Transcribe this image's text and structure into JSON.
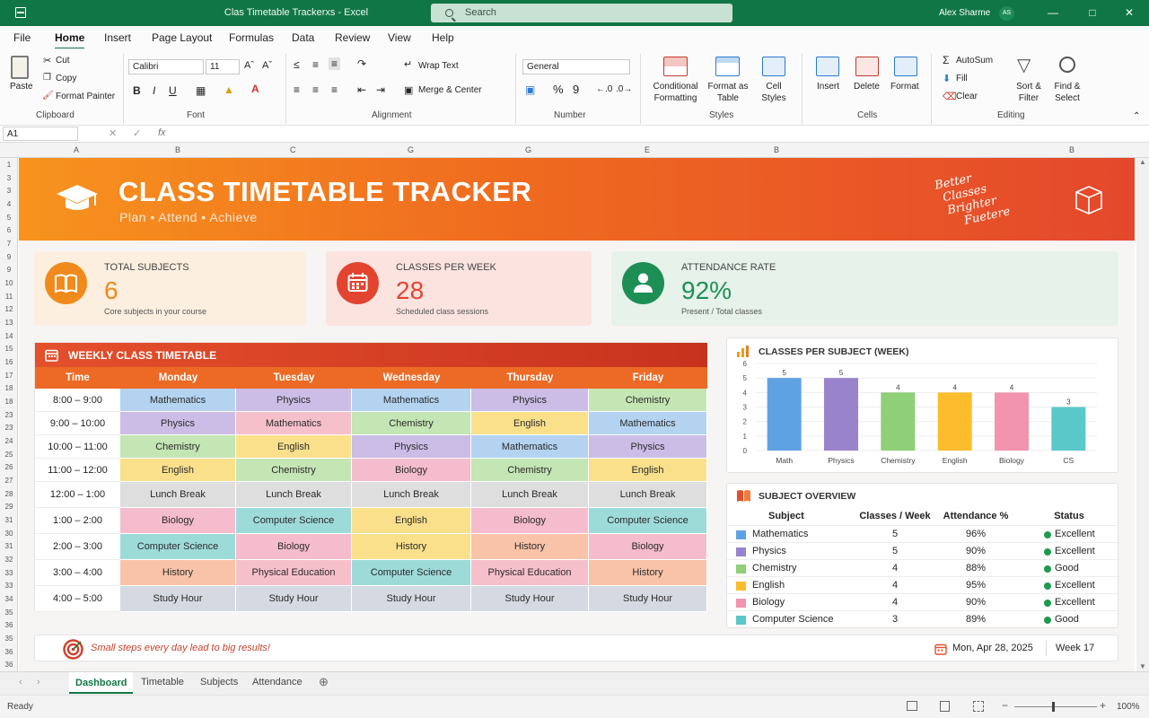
{
  "window": {
    "title": "Clas Timetable Trackerxs - Excel",
    "search_placeholder": "Search",
    "user_name": "Alex Sharme",
    "user_initials": "AS"
  },
  "menu": {
    "tabs": [
      "File",
      "Home",
      "Insert",
      "Page Layout",
      "Formulas",
      "Data",
      "Review",
      "View",
      "Help"
    ],
    "active": "Home"
  },
  "ribbon": {
    "clipboard": {
      "paste": "Paste",
      "cut": "Cut",
      "copy": "Copy",
      "format_painter": "Format Painter",
      "group": "Clipboard"
    },
    "font": {
      "name": "Calibri",
      "size": "11",
      "bold": "B",
      "italic": "I",
      "underline": "U",
      "group": "Font"
    },
    "alignment": {
      "wrap_text": "Wrap Text",
      "merge_center": "Merge & Center",
      "group": "Alignment"
    },
    "number": {
      "format": "General",
      "group": "Number"
    },
    "styles": {
      "conditional": "Conditional Formatting",
      "format_table": "Format as Table",
      "cell_styles": "Cell Styles",
      "group": "Styles"
    },
    "cells": {
      "insert": "Insert",
      "delete": "Delete",
      "format": "Format",
      "group": "Cells"
    },
    "editing": {
      "autosum": "AutoSum",
      "fill": "Fill",
      "clear": "Clear",
      "sort_filter": "Sort & Filter",
      "find_select": "Find & Select",
      "group": "Editing"
    }
  },
  "formula_bar": {
    "cell_ref": "A1",
    "fx": "fx",
    "content": ""
  },
  "columns": [
    "A",
    "B",
    "C",
    "G",
    "G",
    "E",
    "B",
    "B"
  ],
  "rows": [
    "1",
    "3",
    "3",
    "4",
    "5",
    "6",
    "7",
    "9",
    "9",
    "10",
    "11",
    "12",
    "13",
    "14",
    "15",
    "16",
    "17",
    "18",
    "18",
    "23",
    "23",
    "24",
    "25",
    "26",
    "27",
    "28",
    "29",
    "31",
    "30",
    "31",
    "32",
    "33",
    "33",
    "34",
    "35",
    "36",
    "35",
    "36",
    "36",
    "38",
    "38",
    "39",
    "10",
    "11",
    "13",
    "14",
    "13",
    "15",
    "16",
    "17",
    "15",
    "15",
    "18",
    "19",
    "19",
    "23",
    "23",
    "24",
    "25",
    "26",
    "26",
    "29",
    "30",
    "31",
    "31",
    "31",
    "32",
    "33",
    "33",
    "34",
    "35",
    "36",
    "35",
    "36",
    "36"
  ],
  "banner": {
    "title": "CLASS TIMETABLE TRACKER",
    "subtitle": "Plan  •  Attend  •  Achieve",
    "motto": [
      "Better",
      "Classes",
      "Brighter",
      "Fuetere"
    ]
  },
  "kpis": [
    {
      "label": "TOTAL SUBJECTS",
      "value": "6",
      "note": "Core subjects in your course",
      "color": "#f08a1c",
      "bg": "#fcefdf",
      "icon": "book-icon"
    },
    {
      "label": "CLASSES PER WEEK",
      "value": "28",
      "note": "Scheduled class sessions",
      "color": "#e3442f",
      "bg": "#fbe3e0",
      "icon": "calendar-icon"
    },
    {
      "label": "ATTENDANCE RATE",
      "value": "92%",
      "note": "Present / Total classes",
      "color": "#1d8f55",
      "bg": "#e6f2ea",
      "icon": "person-icon"
    }
  ],
  "timetable": {
    "title": "WEEKLY CLASS TIMETABLE",
    "headers": [
      "Time",
      "Monday",
      "Tuesday",
      "Wednesday",
      "Thursday",
      "Friday"
    ],
    "rows": [
      {
        "time": "8:00 – 9:00",
        "cells": [
          "Mathematics",
          "Physics",
          "Mathematics",
          "Physics",
          "Chemistry"
        ]
      },
      {
        "time": "9:00 – 10:00",
        "cells": [
          "Physics",
          "Mathematics",
          "Chemistry",
          "English",
          "Mathematics"
        ]
      },
      {
        "time": "10:00 – 11:00",
        "cells": [
          "Chemistry",
          "English",
          "Physics",
          "Mathematics",
          "Physics"
        ]
      },
      {
        "time": "11:00 – 12:00",
        "cells": [
          "English",
          "Chemistry",
          "Biology",
          "Chemistry",
          "English"
        ]
      },
      {
        "time": "12:00 – 1:00",
        "cells": [
          "Lunch Break",
          "Lunch Break",
          "Lunch Break",
          "Lunch Break",
          "Lunch Break"
        ]
      },
      {
        "time": "1:00 – 2:00",
        "cells": [
          "Biology",
          "Computer Science",
          "English",
          "Biology",
          "Computer Science"
        ]
      },
      {
        "time": "2:00 – 3:00",
        "cells": [
          "Computer Science",
          "Biology",
          "History",
          "History",
          "Biology"
        ]
      },
      {
        "time": "3:00 – 4:00",
        "cells": [
          "History",
          "Physical Education",
          "Computer Science",
          "Physical Education",
          "History"
        ]
      },
      {
        "time": "4:00 – 5:00",
        "cells": [
          "Study Hour",
          "Study Hour",
          "Study Hour",
          "Study Hour",
          "Study Hour"
        ]
      }
    ]
  },
  "subject_colors": {
    "Mathematics": "#b3d3f1",
    "Physics": "#cbbde6",
    "Chemistry": "#c4e5b4",
    "English": "#fbe08c",
    "Biology": "#f5bccd",
    "Computer Science": "#9ddbd9",
    "History": "#f8c3a8",
    "Physical Education": "#f6c0cb",
    "Lunch Break": "#dedede",
    "Study Hour": "#d5d9e1"
  },
  "subject_colors_alt": {
    "1-1": "#f6c0cb",
    "5-4": "#9ddbd9",
    "6-2": "#fbe08c"
  },
  "chart_data": {
    "type": "bar",
    "title": "CLASSES PER SUBJECT (WEEK)",
    "categories": [
      "Math",
      "Physics",
      "Chemistry",
      "English",
      "Biology",
      "CS"
    ],
    "values": [
      5,
      5,
      4,
      4,
      4,
      3
    ],
    "colors": [
      "#5fa2e4",
      "#9a83cd",
      "#8fcf78",
      "#fbbd2c",
      "#f294ae",
      "#5ac7c9"
    ],
    "ylim": [
      0,
      6
    ],
    "yticks": [
      "0",
      "1",
      "2",
      "3",
      "4",
      "5",
      "6"
    ],
    "grid": true
  },
  "overview": {
    "title": "SUBJECT OVERVIEW",
    "headers": [
      "Subject",
      "Classes / Week",
      "Attendance %",
      "Status"
    ],
    "rows": [
      {
        "subject": "Mathematics",
        "classes": "5",
        "attendance": "96%",
        "status": "Excellent",
        "color": "#5fa2e4"
      },
      {
        "subject": "Physics",
        "classes": "5",
        "attendance": "90%",
        "status": "Excellent",
        "color": "#9a83cd"
      },
      {
        "subject": "Chemistry",
        "classes": "4",
        "attendance": "88%",
        "status": "Good",
        "color": "#8fcf78"
      },
      {
        "subject": "English",
        "classes": "4",
        "attendance": "95%",
        "status": "Excellent",
        "color": "#fbbd2c"
      },
      {
        "subject": "Biology",
        "classes": "4",
        "attendance": "90%",
        "status": "Excellent",
        "color": "#f294ae"
      },
      {
        "subject": "Computer Science",
        "classes": "3",
        "attendance": "89%",
        "status": "Good",
        "color": "#5ac7c9"
      }
    ],
    "status_color": "#1d9a4f"
  },
  "footer": {
    "quote": "Small steps every day lead to big results!",
    "date": "Mon, Apr 28, 2025",
    "week": "Week 17"
  },
  "sheets": {
    "tabs": [
      "Dashboard",
      "Timetable",
      "Subjects",
      "Attendance"
    ],
    "active": "Dashboard"
  },
  "status": {
    "ready": "Ready",
    "zoom": "100%"
  }
}
